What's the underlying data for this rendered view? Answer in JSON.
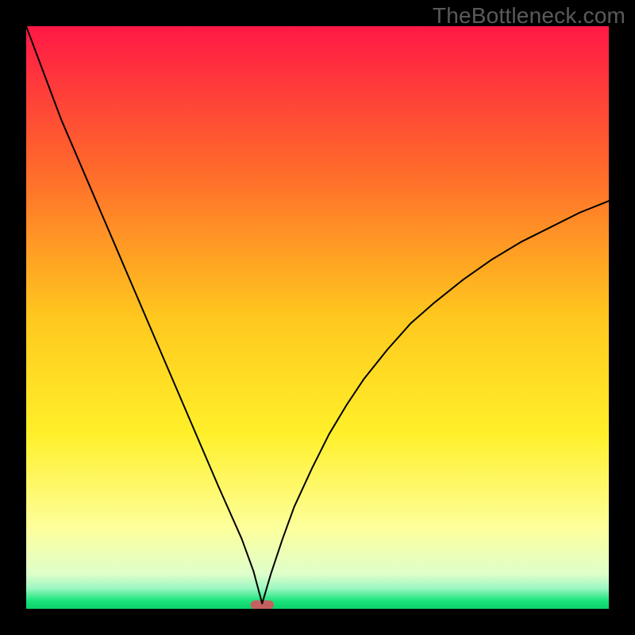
{
  "watermark": "TheBottleneck.com",
  "chart_data": {
    "type": "line",
    "title": "",
    "xlabel": "",
    "ylabel": "",
    "xlim": [
      0,
      100
    ],
    "ylim": [
      0,
      100
    ],
    "grid": false,
    "background": {
      "type": "vertical-gradient",
      "stops": [
        {
          "pos": 0.0,
          "color": "#ff1846"
        },
        {
          "pos": 0.25,
          "color": "#ff6b2b"
        },
        {
          "pos": 0.5,
          "color": "#ffc81e"
        },
        {
          "pos": 0.7,
          "color": "#fff02a"
        },
        {
          "pos": 0.86,
          "color": "#fdff9b"
        },
        {
          "pos": 0.94,
          "color": "#dfffca"
        },
        {
          "pos": 0.965,
          "color": "#9bf7c1"
        },
        {
          "pos": 0.985,
          "color": "#1fe57e"
        },
        {
          "pos": 1.0,
          "color": "#0ad16a"
        }
      ]
    },
    "target_marker": {
      "x": 40.5,
      "y": 0.7,
      "width": 4.0,
      "height": 1.5,
      "color": "#c66060"
    },
    "series": [
      {
        "name": "curve",
        "color": "#000000",
        "stroke_width": 2,
        "x": [
          0.0,
          3.0,
          6.0,
          9.0,
          12.0,
          15.0,
          18.0,
          21.0,
          24.0,
          27.0,
          30.0,
          33.0,
          35.0,
          37.0,
          39.0,
          40.5,
          42.0,
          44.0,
          46.0,
          49.0,
          52.0,
          55.0,
          58.0,
          62.0,
          66.0,
          70.0,
          75.0,
          80.0,
          85.0,
          90.0,
          95.0,
          100.0
        ],
        "y": [
          100.0,
          92.0,
          84.0,
          77.0,
          70.0,
          63.0,
          56.0,
          49.0,
          42.0,
          35.0,
          28.0,
          21.0,
          16.5,
          12.0,
          6.5,
          0.9,
          6.0,
          12.0,
          17.5,
          24.0,
          30.0,
          35.0,
          39.5,
          44.5,
          49.0,
          52.5,
          56.5,
          60.0,
          63.0,
          65.5,
          68.0,
          70.0
        ]
      }
    ]
  }
}
